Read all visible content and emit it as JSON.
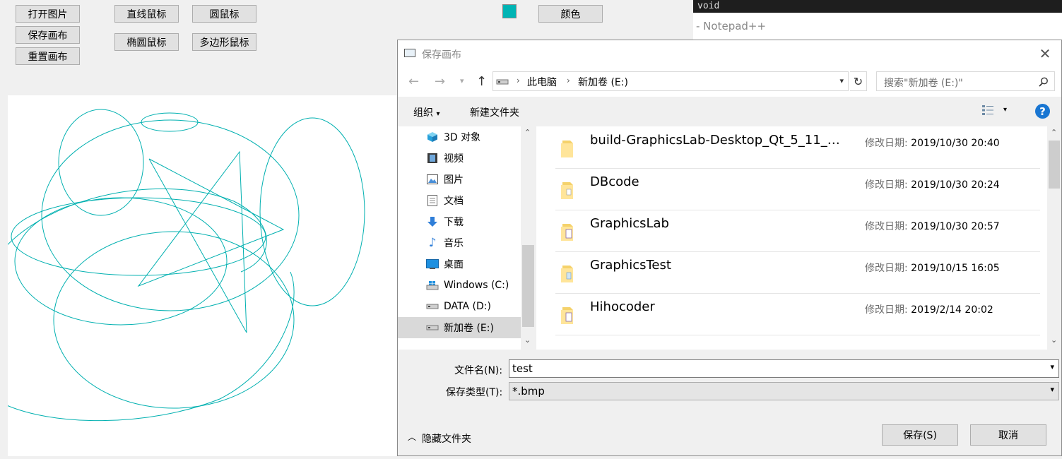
{
  "app": {
    "buttons": {
      "open_image": "打开图片",
      "save_canvas": "保存画布",
      "reset_canvas": "重置画布",
      "line_mouse": "直线鼠标",
      "circle_mouse": "圆鼠标",
      "ellipse_mouse": "椭圆鼠标",
      "polygon_mouse": "多边形鼠标",
      "color": "颜色"
    },
    "colors": {
      "stroke": "#00b0b0",
      "swatch": "#00b4b4"
    }
  },
  "background_window": {
    "code_text": "void",
    "title_fragment": "- Notepad++"
  },
  "dialog": {
    "title": "保存画布",
    "address": {
      "segments": [
        "此电脑",
        "新加卷 (E:)"
      ]
    },
    "search_placeholder": "搜索\"新加卷 (E:)\"",
    "toolbar": {
      "organize": "组织",
      "new_folder": "新建文件夹",
      "help": "?"
    },
    "tree": [
      {
        "label": "3D 对象",
        "icon": "3d-objects-icon",
        "selected": false
      },
      {
        "label": "视频",
        "icon": "video-icon",
        "selected": false
      },
      {
        "label": "图片",
        "icon": "pictures-icon",
        "selected": false
      },
      {
        "label": "文档",
        "icon": "documents-icon",
        "selected": false
      },
      {
        "label": "下载",
        "icon": "download-icon",
        "selected": false
      },
      {
        "label": "音乐",
        "icon": "music-icon",
        "selected": false
      },
      {
        "label": "桌面",
        "icon": "desktop-icon",
        "selected": false
      },
      {
        "label": "Windows (C:)",
        "icon": "windows-drive-icon",
        "selected": false
      },
      {
        "label": "DATA (D:)",
        "icon": "drive-icon",
        "selected": false
      },
      {
        "label": "新加卷 (E:)",
        "icon": "drive-icon",
        "selected": true
      }
    ],
    "files": [
      {
        "name": "build-GraphicsLab-Desktop_Qt_5_11_2_...",
        "date_label": "修改日期:",
        "date": "2019/10/30 20:40"
      },
      {
        "name": "DBcode",
        "date_label": "修改日期:",
        "date": "2019/10/30 20:24"
      },
      {
        "name": "GraphicsLab",
        "date_label": "修改日期:",
        "date": "2019/10/30 20:57"
      },
      {
        "name": "GraphicsTest",
        "date_label": "修改日期:",
        "date": "2019/10/15 16:05"
      },
      {
        "name": "Hihocoder",
        "date_label": "修改日期:",
        "date": "2019/2/14 20:02"
      }
    ],
    "filename_label": "文件名(N):",
    "filename_value": "test",
    "filetype_label": "保存类型(T):",
    "filetype_value": "*.bmp",
    "hide_folders": "隐藏文件夹",
    "save_button": "保存(S)",
    "cancel_button": "取消"
  }
}
